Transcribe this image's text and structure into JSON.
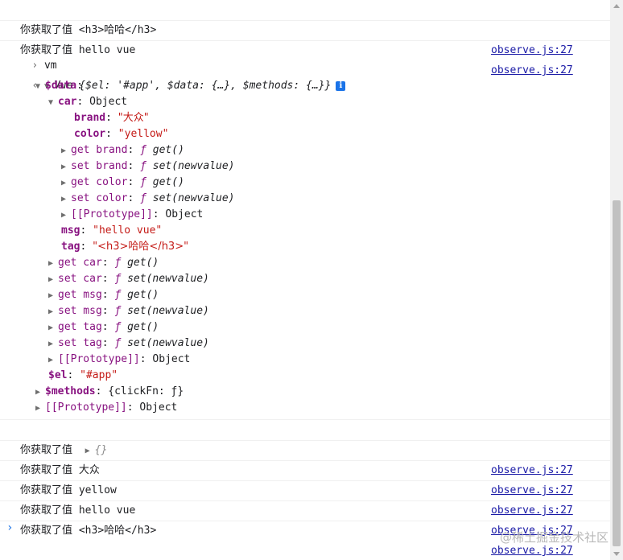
{
  "log_label": "你获取了值",
  "source_link": "observe.js:27",
  "top_logs": [
    {
      "value": "<h3>哈哈</h3>"
    },
    {
      "value": "hello vue"
    }
  ],
  "input_command": "vm",
  "vm": {
    "class_name": "Vue",
    "preview": "{$el: '#app', $data: {…}, $methods: {…}}",
    "info_icon": "info-icon",
    "data_key": "$data",
    "car_key": "car",
    "car_type": "Object",
    "brand_key": "brand",
    "brand_value": "\"大众\"",
    "color_key": "color",
    "color_value": "\"yellow\"",
    "msg_key": "msg",
    "msg_value": "\"hello vue\"",
    "tag_key": "tag",
    "tag_value": "\"<h3>哈哈</h3>\"",
    "accessors_car": [
      {
        "key": "get brand",
        "fn": "get()"
      },
      {
        "key": "set brand",
        "fn": "set(newvalue)"
      },
      {
        "key": "get color",
        "fn": "get()"
      },
      {
        "key": "set color",
        "fn": "set(newvalue)"
      }
    ],
    "accessors_data": [
      {
        "key": "get car",
        "fn": "get()"
      },
      {
        "key": "set car",
        "fn": "set(newvalue)"
      },
      {
        "key": "get msg",
        "fn": "get()"
      },
      {
        "key": "set msg",
        "fn": "set(newvalue)"
      },
      {
        "key": "get tag",
        "fn": "get()"
      },
      {
        "key": "set tag",
        "fn": "set(newvalue)"
      }
    ],
    "prototype_key": "[[Prototype]]",
    "prototype_value": "Object",
    "el_key": "$el",
    "el_value": "\"#app\"",
    "methods_key": "$methods",
    "methods_value": "{clickFn: ƒ}",
    "f_symbol": "ƒ"
  },
  "bottom_logs": [
    {
      "value": "{}"
    },
    {
      "value": "大众"
    },
    {
      "value": "yellow"
    },
    {
      "value": "hello vue"
    },
    {
      "value": "<h3>哈哈</h3>"
    }
  ],
  "watermark": "@稀土掘金技术社区",
  "colors": {
    "key": "#881280",
    "string": "#c41a16",
    "link": "#1a1aa6",
    "info": "#1a73e8"
  }
}
